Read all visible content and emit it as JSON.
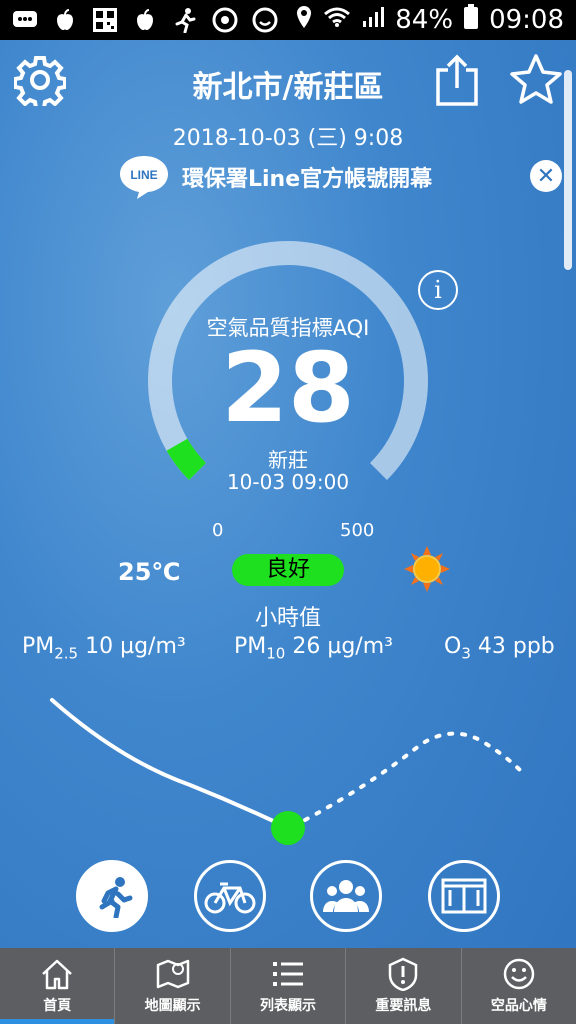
{
  "status_bar": {
    "battery": "84%",
    "time": "09:08",
    "left_icons": [
      "message-icon",
      "apple-icon",
      "qr-icon",
      "apple-icon",
      "runner-icon",
      "chrome-icon",
      "smile-icon"
    ]
  },
  "header": {
    "title": "新北市/新莊區",
    "datetime": "2018-10-03 (三) 9:08"
  },
  "banner": {
    "logo_text": "LINE",
    "text": "環保署Line官方帳號開幕",
    "close_label": "✕"
  },
  "aqi": {
    "label": "空氣品質指標AQI",
    "value": "28",
    "gauge_value": 28,
    "gauge_max": 500,
    "station": "新莊",
    "station_time": "10-03 09:00",
    "scale_min": "0",
    "scale_max": "500",
    "info_label": "i",
    "level_color": "#1ee01e"
  },
  "weather": {
    "temperature": "25℃",
    "status": "良好",
    "icon": "sun-icon"
  },
  "hourly_label": "小時值",
  "pollutants": {
    "pm25": {
      "name": "PM",
      "sub": "2.5",
      "value": "10 µg/m³"
    },
    "pm10": {
      "name": "PM",
      "sub": "10",
      "value": "26 µg/m³"
    },
    "o3": {
      "name": "O",
      "sub": "3",
      "value": "43 ppb"
    }
  },
  "activities": [
    {
      "name": "running-icon",
      "active": true
    },
    {
      "name": "bicycle-icon",
      "active": false
    },
    {
      "name": "group-icon",
      "active": false
    },
    {
      "name": "window-icon",
      "active": false
    }
  ],
  "nav": {
    "items": [
      {
        "label": "首頁",
        "icon": "home-icon"
      },
      {
        "label": "地圖顯示",
        "icon": "map-icon"
      },
      {
        "label": "列表顯示",
        "icon": "list-icon"
      },
      {
        "label": "重要訊息",
        "icon": "alert-icon"
      },
      {
        "label": "空品心情",
        "icon": "smile-icon"
      }
    ]
  },
  "colors": {
    "good": "#1ee01e",
    "nav_bg": "#5c5e61",
    "active_accent": "#2d8fe0"
  }
}
